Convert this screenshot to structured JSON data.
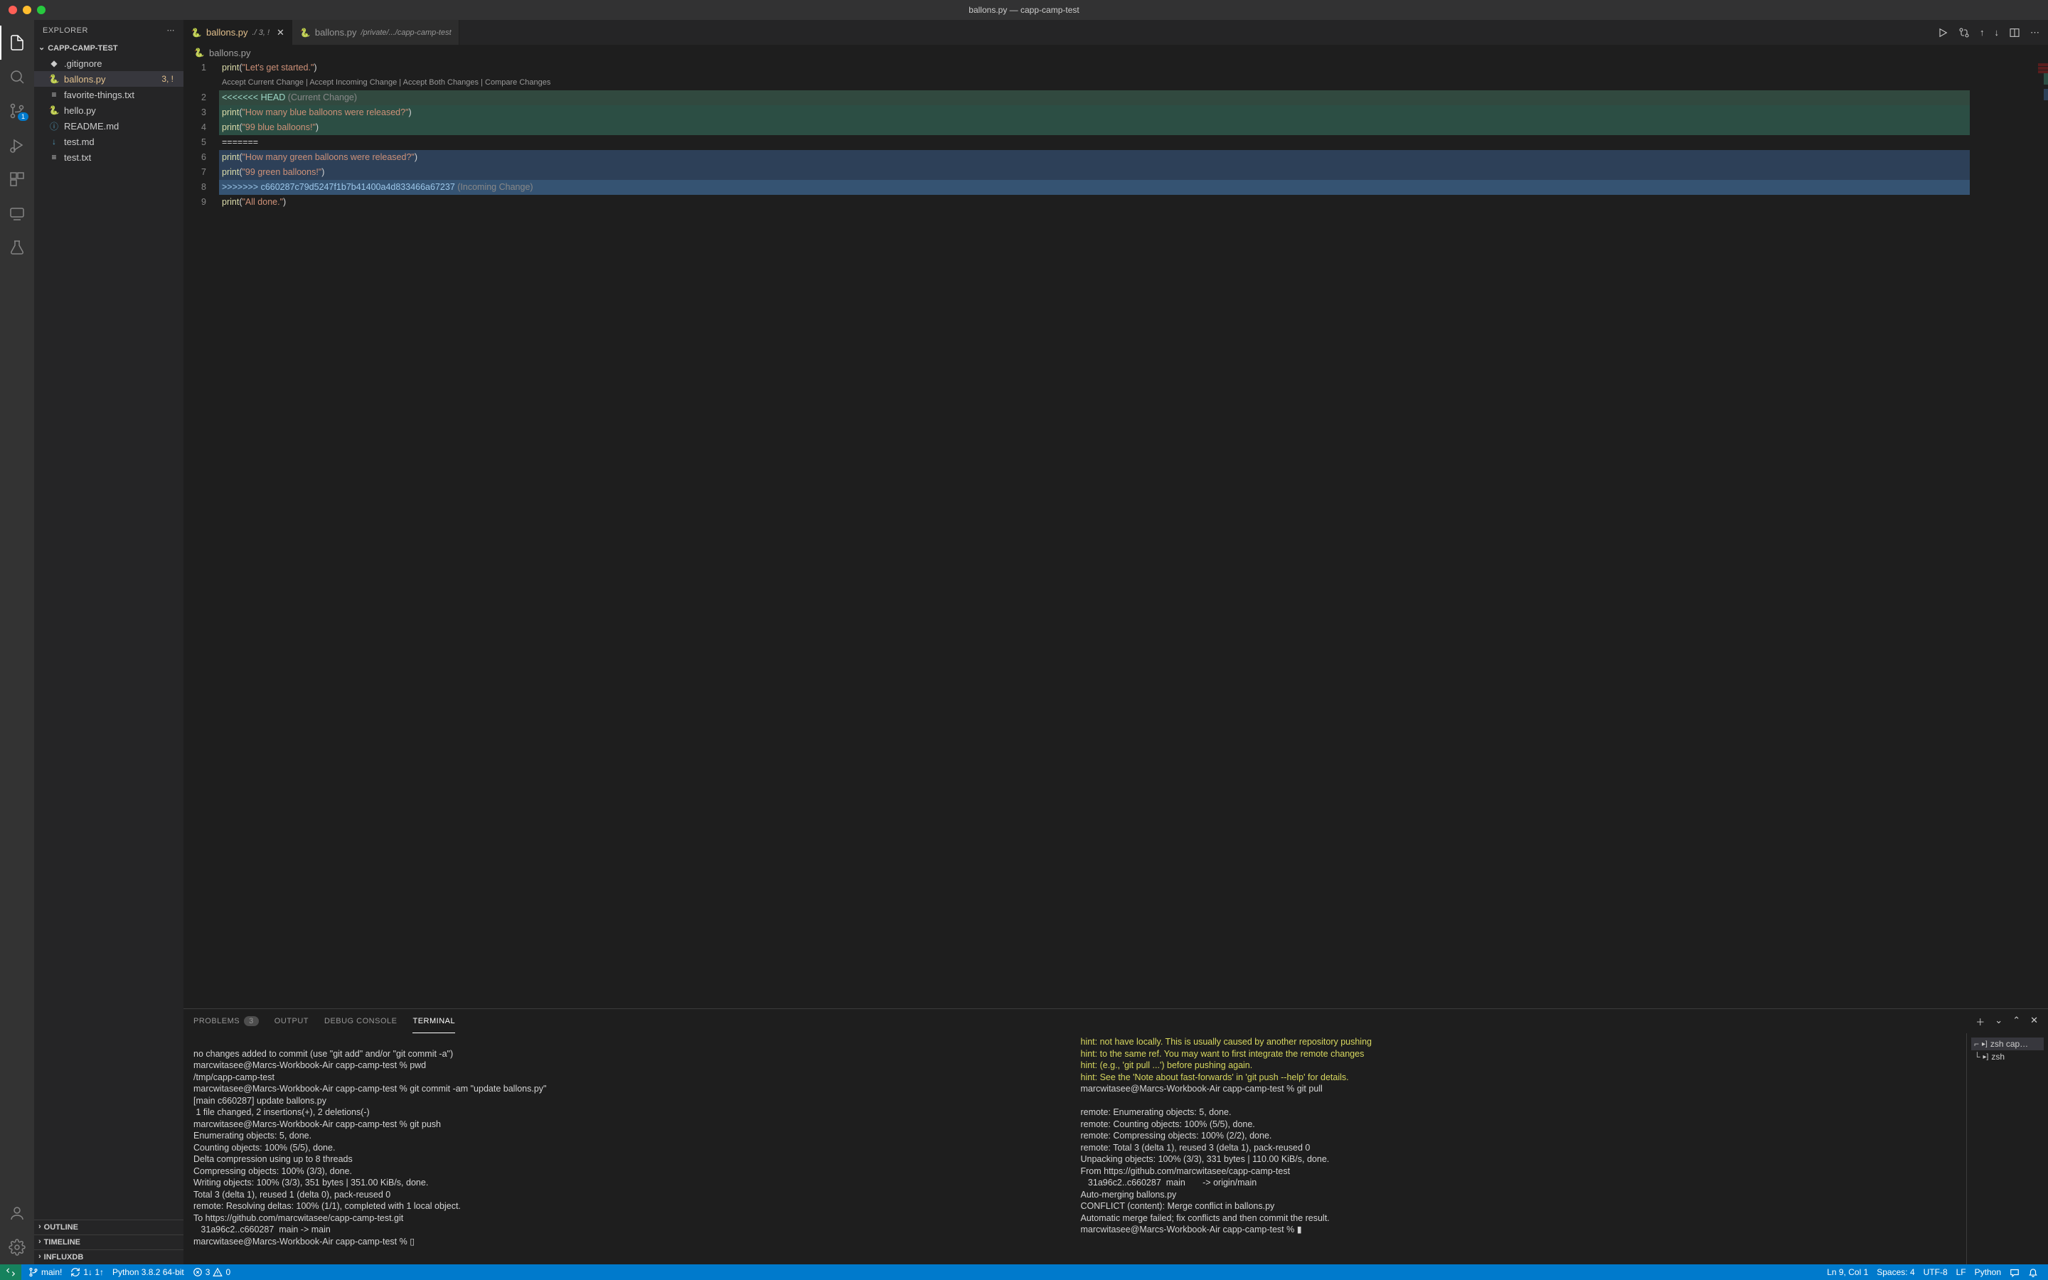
{
  "window_title": "ballons.py — capp-camp-test",
  "sidebar": {
    "explorer_label": "EXPLORER",
    "project_name": "CAPP-CAMP-TEST",
    "files": [
      {
        "icon": "git-ignore-icon",
        "name": ".gitignore",
        "active": false
      },
      {
        "icon": "python-icon",
        "name": "ballons.py",
        "active": true,
        "status": "3, !"
      },
      {
        "icon": "text-icon",
        "name": "favorite-things.txt",
        "active": false
      },
      {
        "icon": "python-icon",
        "name": "hello.py",
        "active": false
      },
      {
        "icon": "info-icon",
        "name": "README.md",
        "active": false
      },
      {
        "icon": "markdown-icon",
        "name": "test.md",
        "active": false
      },
      {
        "icon": "text-icon",
        "name": "test.txt",
        "active": false
      }
    ],
    "outline_label": "OUTLINE",
    "timeline_label": "TIMELINE",
    "influxdb_label": "INFLUXDB"
  },
  "tabs": [
    {
      "icon": "python-icon",
      "name": "ballons.py",
      "path": "./ 3, !",
      "active": true,
      "closable": true
    },
    {
      "icon": "python-icon",
      "name": "ballons.py",
      "path": "/private/.../capp-camp-test",
      "active": false,
      "closable": false
    }
  ],
  "breadcrumb": {
    "icon": "python-icon",
    "file": "ballons.py"
  },
  "codelens": {
    "accept_current": "Accept Current Change",
    "accept_incoming": "Accept Incoming Change",
    "accept_both": "Accept Both Changes",
    "compare": "Compare Changes"
  },
  "code_lines": [
    {
      "n": 1,
      "tokens": [
        [
          "fn",
          "print"
        ],
        [
          "p",
          "("
        ],
        [
          "s",
          "\"Let's get started.\""
        ],
        [
          "p",
          ")"
        ]
      ],
      "bg": ""
    },
    {
      "n": 2,
      "tokens": [
        [
          "mc",
          "<<<<<<< HEAD "
        ],
        [
          "lbl",
          "(Current Change)"
        ]
      ],
      "bg": "bg-current-full"
    },
    {
      "n": 3,
      "tokens": [
        [
          "fn",
          "print"
        ],
        [
          "p",
          "("
        ],
        [
          "s",
          "\"How many blue balloons were released?\""
        ],
        [
          "p",
          ")"
        ]
      ],
      "bg": "bg-current"
    },
    {
      "n": 4,
      "tokens": [
        [
          "fn",
          "print"
        ],
        [
          "p",
          "("
        ],
        [
          "s",
          "\"99 blue balloons!\""
        ],
        [
          "p",
          ")"
        ]
      ],
      "bg": "bg-current"
    },
    {
      "n": 5,
      "tokens": [
        [
          "p",
          "======="
        ]
      ],
      "bg": ""
    },
    {
      "n": 6,
      "tokens": [
        [
          "fn",
          "print"
        ],
        [
          "p",
          "("
        ],
        [
          "s",
          "\"How many green balloons were released?\""
        ],
        [
          "p",
          ")"
        ]
      ],
      "bg": "bg-incoming"
    },
    {
      "n": 7,
      "tokens": [
        [
          "fn",
          "print"
        ],
        [
          "p",
          "("
        ],
        [
          "s",
          "\"99 green balloons!\""
        ],
        [
          "p",
          ")"
        ]
      ],
      "bg": "bg-incoming"
    },
    {
      "n": 8,
      "tokens": [
        [
          "mi",
          ">>>>>>> c660287c79d5247f1b7b41400a4d833466a67237 "
        ],
        [
          "lbl",
          "(Incoming Change)"
        ]
      ],
      "bg": "bg-incoming-full"
    },
    {
      "n": 9,
      "tokens": [
        [
          "fn",
          "print"
        ],
        [
          "p",
          "("
        ],
        [
          "s",
          "\"All done.\""
        ],
        [
          "p",
          ")"
        ]
      ],
      "bg": ""
    }
  ],
  "panel": {
    "problems": "PROBLEMS",
    "problems_badge": "3",
    "output": "OUTPUT",
    "debug_console": "DEBUG CONSOLE",
    "terminal": "TERMINAL"
  },
  "terminal_left": "\nno changes added to commit (use \"git add\" and/or \"git commit -a\")\nmarcwitasee@Marcs-Workbook-Air capp-camp-test % pwd\n/tmp/capp-camp-test\nmarcwitasee@Marcs-Workbook-Air capp-camp-test % git commit -am \"update ballons.py\"\n[main c660287] update ballons.py\n 1 file changed, 2 insertions(+), 2 deletions(-)\nmarcwitasee@Marcs-Workbook-Air capp-camp-test % git push\nEnumerating objects: 5, done.\nCounting objects: 100% (5/5), done.\nDelta compression using up to 8 threads\nCompressing objects: 100% (3/3), done.\nWriting objects: 100% (3/3), 351 bytes | 351.00 KiB/s, done.\nTotal 3 (delta 1), reused 1 (delta 0), pack-reused 0\nremote: Resolving deltas: 100% (1/1), completed with 1 local object.\nTo https://github.com/marcwitasee/capp-camp-test.git\n   31a96c2..c660287  main -> main\nmarcwitasee@Marcs-Workbook-Air capp-camp-test % ▯",
  "terminal_right_hints": "hint: not have locally. This is usually caused by another repository pushing\nhint: to the same ref. You may want to first integrate the remote changes\nhint: (e.g., 'git pull ...') before pushing again.\nhint: See the 'Note about fast-forwards' in 'git push --help' for details.",
  "terminal_right_rest": "marcwitasee@Marcs-Workbook-Air capp-camp-test % git pull\n\nremote: Enumerating objects: 5, done.\nremote: Counting objects: 100% (5/5), done.\nremote: Compressing objects: 100% (2/2), done.\nremote: Total 3 (delta 1), reused 3 (delta 1), pack-reused 0\nUnpacking objects: 100% (3/3), 331 bytes | 110.00 KiB/s, done.\nFrom https://github.com/marcwitasee/capp-camp-test\n   31a96c2..c660287  main       -> origin/main\nAuto-merging ballons.py\nCONFLICT (content): Merge conflict in ballons.py\nAutomatic merge failed; fix conflicts and then commit the result.\nmarcwitasee@Marcs-Workbook-Air capp-camp-test % ▮",
  "terminals": [
    {
      "name": "zsh cap…",
      "split": true,
      "active": true
    },
    {
      "name": "zsh",
      "split": false,
      "active": false
    }
  ],
  "status": {
    "branch": "main!",
    "sync": "1↓ 1↑",
    "python": "Python 3.8.2 64-bit",
    "errors": "3",
    "warnings": "0",
    "cursor": "Ln 9, Col 1",
    "spaces": "Spaces: 4",
    "encoding": "UTF-8",
    "eol": "LF",
    "language": "Python"
  }
}
